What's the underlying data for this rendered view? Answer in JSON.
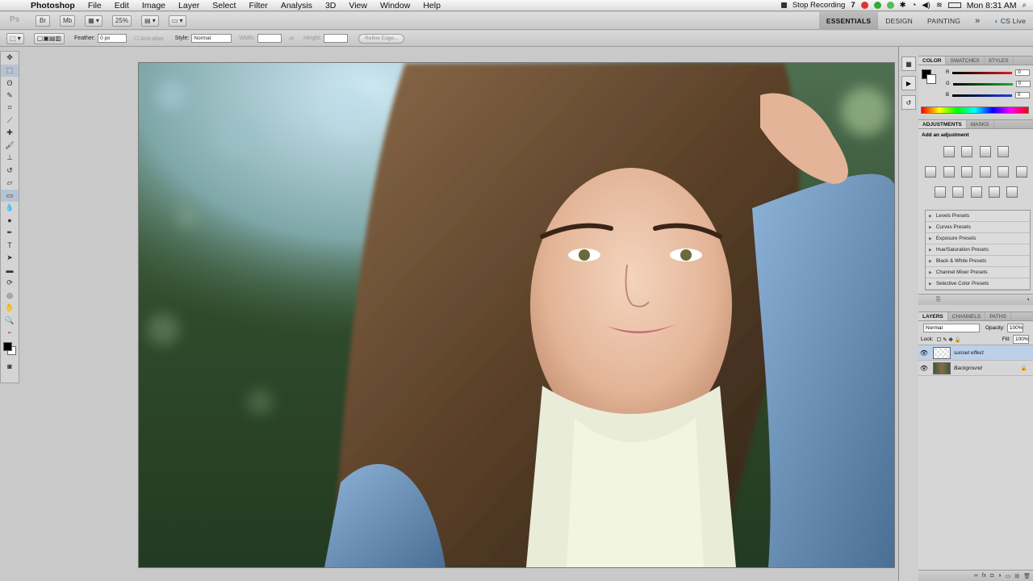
{
  "menubar": {
    "apple": "",
    "items": [
      "Photoshop",
      "File",
      "Edit",
      "Image",
      "Layer",
      "Select",
      "Filter",
      "Analysis",
      "3D",
      "View",
      "Window",
      "Help"
    ],
    "status": {
      "recording": "Stop Recording",
      "num": "7",
      "clock": "Mon 8:31 AM"
    }
  },
  "appbar": {
    "zoom": "25%",
    "workspaces": [
      "ESSENTIALS",
      "DESIGN",
      "PAINTING"
    ],
    "more": "»",
    "cs_live": "CS Live"
  },
  "options": {
    "feather_label": "Feather:",
    "feather_value": "0 px",
    "antialias": "Anti-alias",
    "style_label": "Style:",
    "style_value": "Normal",
    "width_label": "Width:",
    "height_label": "Height:",
    "refine": "Refine Edge..."
  },
  "color_panel": {
    "tabs": [
      "COLOR",
      "SWATCHES",
      "STYLES"
    ],
    "channels": [
      {
        "label": "R",
        "value": "0",
        "color": "#e02020"
      },
      {
        "label": "G",
        "value": "0",
        "color": "#1fb030"
      },
      {
        "label": "B",
        "value": "0",
        "color": "#2040e0"
      }
    ]
  },
  "adjustments_panel": {
    "tabs": [
      "ADJUSTMENTS",
      "MASKS"
    ],
    "heading": "Add an adjustment",
    "presets": [
      "Levels Presets",
      "Curves Presets",
      "Exposure Presets",
      "Hue/Saturation Presets",
      "Black & White Presets",
      "Channel Mixer Presets",
      "Selective Color Presets"
    ]
  },
  "layers_panel": {
    "tabs": [
      "LAYERS",
      "CHANNELS",
      "PATHS"
    ],
    "blend_mode": "Normal",
    "opacity_label": "Opacity:",
    "opacity_value": "100%",
    "lock_label": "Lock:",
    "fill_label": "Fill:",
    "fill_value": "100%",
    "layers": [
      {
        "name": "sunset effect",
        "selected": true
      },
      {
        "name": "Background",
        "selected": false
      }
    ]
  }
}
